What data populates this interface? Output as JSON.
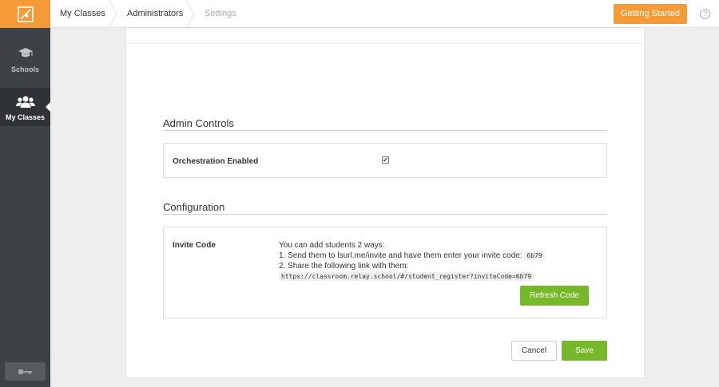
{
  "sidebar": {
    "items": [
      {
        "label": "Schools",
        "icon": "graduation-cap-icon"
      },
      {
        "label": "My Classes",
        "icon": "group-icon",
        "active": true
      }
    ],
    "bottom_icon": "key-icon"
  },
  "breadcrumb": [
    "My Classes",
    "Administrators",
    "Settings"
  ],
  "header": {
    "getting_started": "Getting Started",
    "help_glyph": "?"
  },
  "admin_controls": {
    "title": "Admin Controls",
    "orchestration_label": "Orchestration Enabled",
    "orchestration_checked": true,
    "check_glyph": "✔"
  },
  "configuration": {
    "title": "Configuration",
    "invite_label": "Invite Code",
    "intro": "You can add students 2 ways:",
    "step1": "1. Send them to lsurl.me/invite and have them enter your invite code:",
    "code": "6b79",
    "step2": "2. Share the following link with them:",
    "link": "https://classroom.relay.school/#/student_register?inviteCode=6b79",
    "refresh_label": "Refresh Code"
  },
  "footer": {
    "cancel_label": "Cancel",
    "save_label": "Save"
  },
  "colors": {
    "accent": "#f49a36",
    "green": "#76b82a",
    "sidebar": "#3d4247"
  }
}
